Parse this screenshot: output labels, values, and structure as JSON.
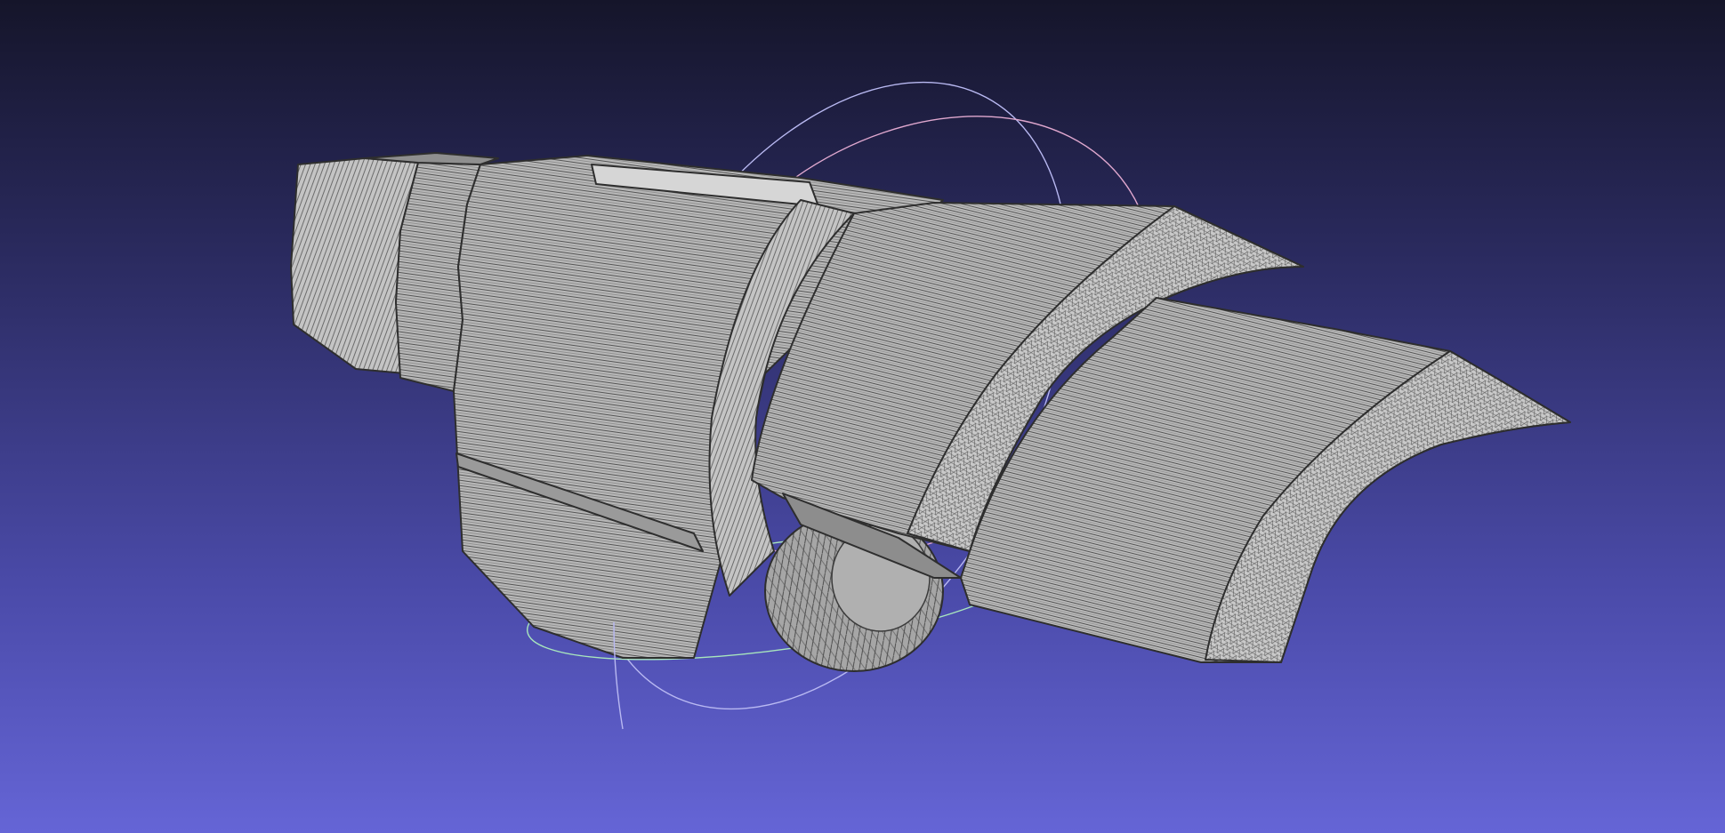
{
  "viewer": {
    "mode": "wireframe-shaded",
    "background_top": "#15152a",
    "background_bottom": "#6565d6",
    "mesh_fill": "#b4b4b4",
    "mesh_edge": "#3a3a3a",
    "trackball_colors": {
      "x_ring": "#e3a4c9",
      "y_ring": "#a4e3b4",
      "z_ring": "#b4b4f0"
    }
  }
}
